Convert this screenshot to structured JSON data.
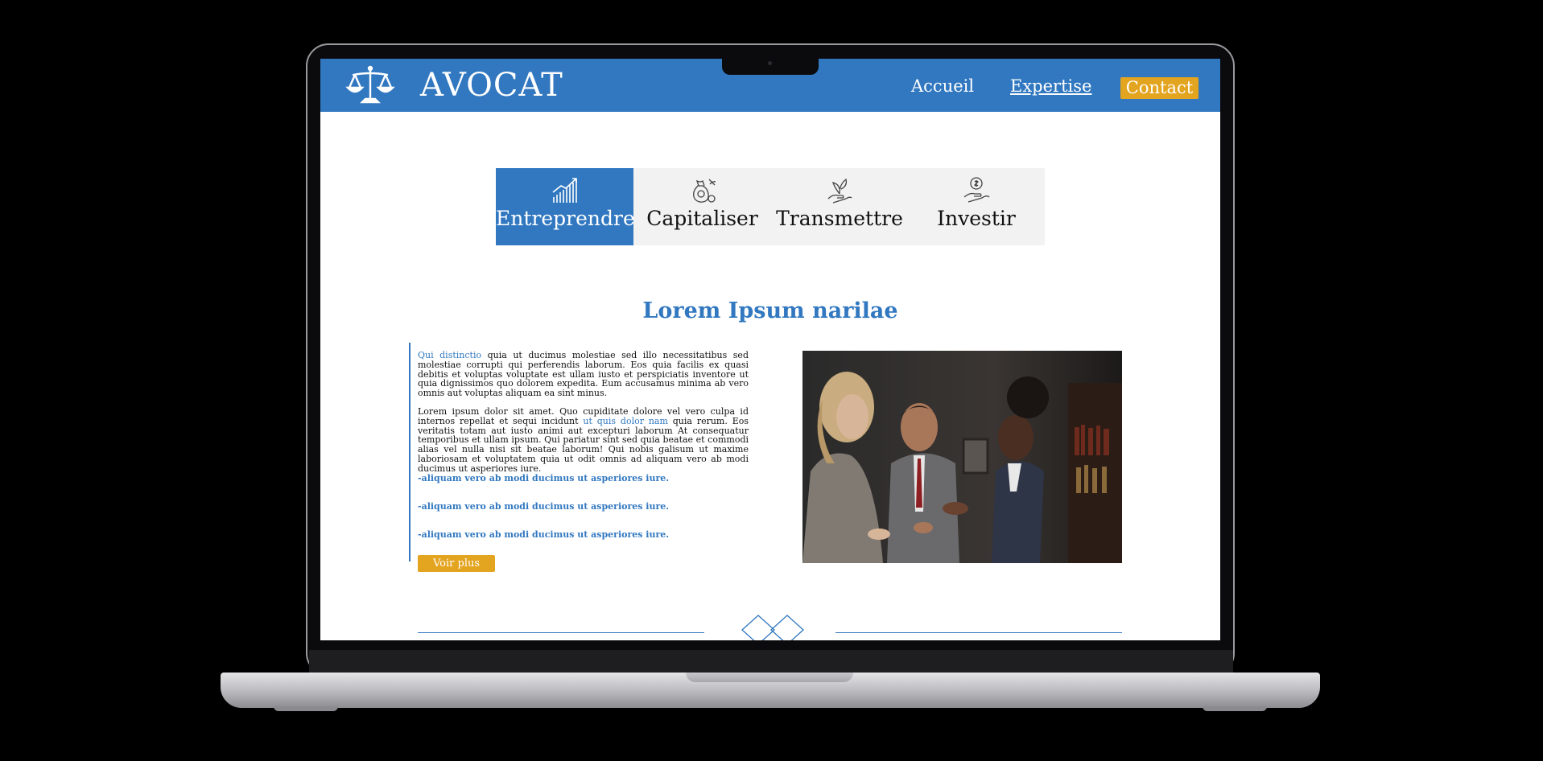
{
  "header": {
    "brand": "AVOCAT",
    "logo_icon": "scales-of-justice-icon",
    "nav": [
      "Accueil",
      "Expertise"
    ],
    "contact": "Contact"
  },
  "tabs": [
    {
      "label": "Entreprendre",
      "icon": "growth-chart-icon",
      "active": true
    },
    {
      "label": "Capitaliser",
      "icon": "money-bag-icon",
      "active": false
    },
    {
      "label": "Transmettre",
      "icon": "hand-plant-icon",
      "active": false
    },
    {
      "label": "Investir",
      "icon": "hand-coin-icon",
      "active": false
    }
  ],
  "section": {
    "title": "Lorem Ipsum narilae",
    "p1_link": "Qui distinctio",
    "p1_text": " quia ut ducimus molestiae sed illo necessitatibus sed molestiae corrupti qui perferendis laborum. Eos quia facilis ex quasi debitis et voluptas voluptate est ullam iusto et perspiciatis inventore ut quia dignissimos quo dolorem expedita. Eum accusamus minima ab vero omnis aut voluptas aliquam ea sint minus.",
    "p2_a": "Lorem ipsum dolor sit amet. Quo cupiditate dolore vel vero culpa id internos repellat et sequi incidunt ",
    "p2_link": "ut quis dolor nam",
    "p2_b": " quia rerum. Eos veritatis totam aut iusto animi aut excepturi laborum At consequatur temporibus et ullam ipsum. Qui pariatur sint sed quia beatae et commodi alias vel nulla nisi sit beatae laborum! Qui nobis galisum ut maxime laboriosam et voluptatem quia ut odit omnis ad aliquam vero ab modi ducimus ut asperiores iure.",
    "bullets": [
      "-aliquam vero ab modi ducimus ut asperiores iure.",
      "-aliquam vero ab modi ducimus ut asperiores iure.",
      "-aliquam vero ab modi ducimus ut asperiores iure."
    ],
    "button": "Voir plus"
  },
  "colors": {
    "primary": "#3178c0",
    "accent": "#e3a41f"
  }
}
